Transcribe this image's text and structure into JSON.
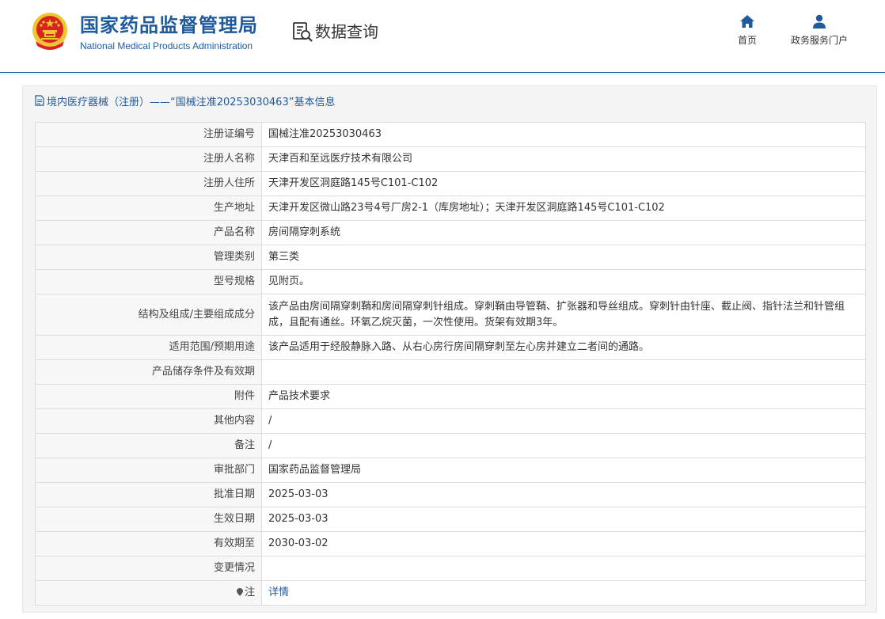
{
  "header": {
    "title": "国家药品监督管理局",
    "subtitle": "National Medical Products Administration",
    "query_label": "数据查询",
    "nav": [
      {
        "label": "首页",
        "icon": "home-icon"
      },
      {
        "label": "政务服务门户",
        "icon": "user-icon"
      }
    ]
  },
  "panel": {
    "heading": "境内医疗器械（注册）——“国械注准20253030463”基本信息"
  },
  "rows": [
    {
      "key": "注册证编号",
      "value": "国械注准20253030463"
    },
    {
      "key": "注册人名称",
      "value": "天津百和至远医疗技术有限公司"
    },
    {
      "key": "注册人住所",
      "value": "天津开发区洞庭路145号C101-C102"
    },
    {
      "key": "生产地址",
      "value": "天津开发区微山路23号4号厂房2-1（库房地址）；天津开发区洞庭路145号C101-C102"
    },
    {
      "key": "产品名称",
      "value": "房间隔穿刺系统"
    },
    {
      "key": "管理类别",
      "value": "第三类"
    },
    {
      "key": "型号规格",
      "value": "见附页。"
    },
    {
      "key": "结构及组成/主要组成成分",
      "value": "该产品由房间隔穿刺鞘和房间隔穿刺针组成。穿刺鞘由导管鞘、扩张器和导丝组成。穿刺针由针座、截止阀、指针法兰和针管组成，且配有通丝。环氧乙烷灭菌，一次性使用。货架有效期3年。"
    },
    {
      "key": "适用范围/预期用途",
      "value": "该产品适用于经股静脉入路、从右心房行房间隔穿刺至左心房并建立二者间的通路。"
    },
    {
      "key": "产品储存条件及有效期",
      "value": ""
    },
    {
      "key": "附件",
      "value": "产品技术要求"
    },
    {
      "key": "其他内容",
      "value": "/"
    },
    {
      "key": "备注",
      "value": "/"
    },
    {
      "key": "审批部门",
      "value": "国家药品监督管理局"
    },
    {
      "key": "批准日期",
      "value": "2025-03-03"
    },
    {
      "key": "生效日期",
      "value": "2025-03-03"
    },
    {
      "key": "有效期至",
      "value": "2030-03-02"
    },
    {
      "key": "变更情况",
      "value": ""
    },
    {
      "key": "注",
      "value": "详情"
    }
  ],
  "colors": {
    "brand": "#1f5a9c",
    "emblem_red": "#d7261f",
    "emblem_gold": "#f2c530"
  }
}
